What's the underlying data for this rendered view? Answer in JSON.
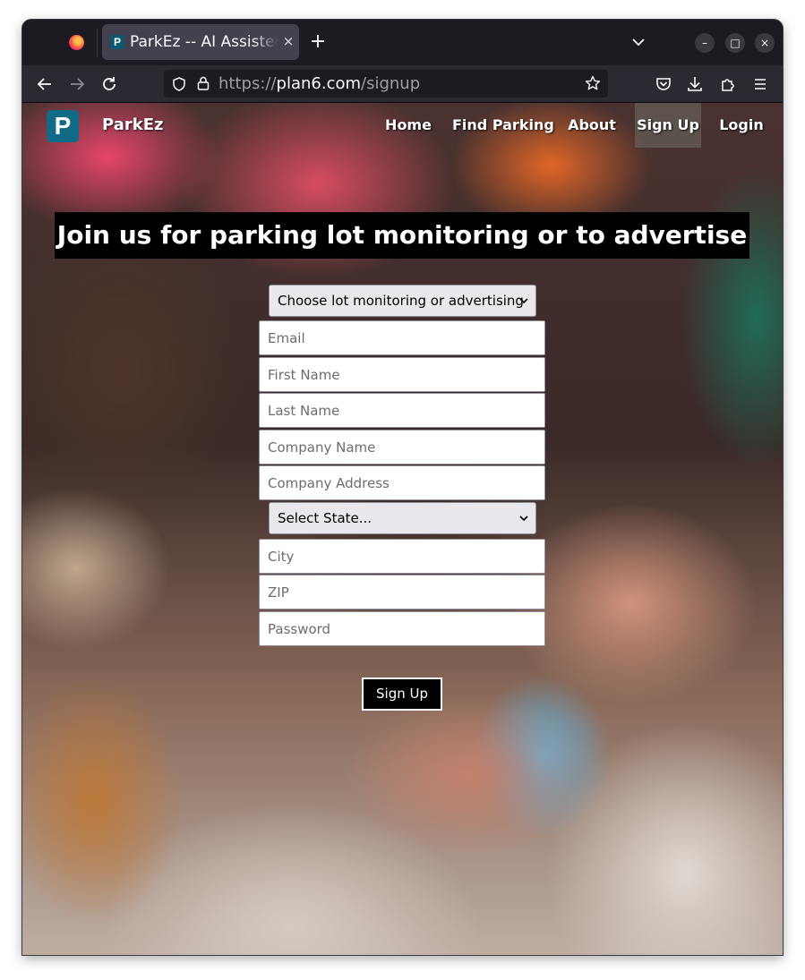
{
  "browser": {
    "tab": {
      "favicon": "P",
      "title": "ParkEz -- AI Assistec",
      "close": "×"
    },
    "new_tab": "+",
    "window_controls": {
      "minimize": "–",
      "maximize": "□",
      "close": "×"
    },
    "url": {
      "scheme": "https://",
      "host": "plan6.com",
      "path": "/signup"
    },
    "icons": [
      "firefox-icon",
      "back-icon",
      "forward-icon",
      "reload-icon",
      "shield-icon",
      "lock-icon",
      "bookmark-star-icon",
      "pocket-icon",
      "downloads-icon",
      "extensions-icon",
      "menu-icon",
      "tab-list-icon"
    ]
  },
  "site": {
    "logo": "P",
    "brand": "ParkEz",
    "nav": [
      {
        "label": "Home"
      },
      {
        "label": "Find Parking"
      },
      {
        "label": "About"
      },
      {
        "label": "Sign Up",
        "active": true
      },
      {
        "label": "Login"
      }
    ],
    "headline": "Join us for parking lot monitoring or to advertise"
  },
  "form": {
    "account_type": {
      "selected": "Choose lot monitoring or advertising"
    },
    "email": {
      "placeholder": "Email",
      "value": ""
    },
    "first_name": {
      "placeholder": "First Name",
      "value": ""
    },
    "last_name": {
      "placeholder": "Last Name",
      "value": ""
    },
    "company_name": {
      "placeholder": "Company Name",
      "value": ""
    },
    "company_address": {
      "placeholder": "Company Address",
      "value": ""
    },
    "state": {
      "selected": "Select State..."
    },
    "city": {
      "placeholder": "City",
      "value": ""
    },
    "zip": {
      "placeholder": "ZIP",
      "value": ""
    },
    "password": {
      "placeholder": "Password",
      "value": ""
    },
    "submit_label": "Sign Up"
  },
  "colors": {
    "brand_logo_bg": "#126b86",
    "headline_bg": "#000000",
    "submit_bg": "#000000",
    "browser_chrome": "#2b2a33"
  }
}
